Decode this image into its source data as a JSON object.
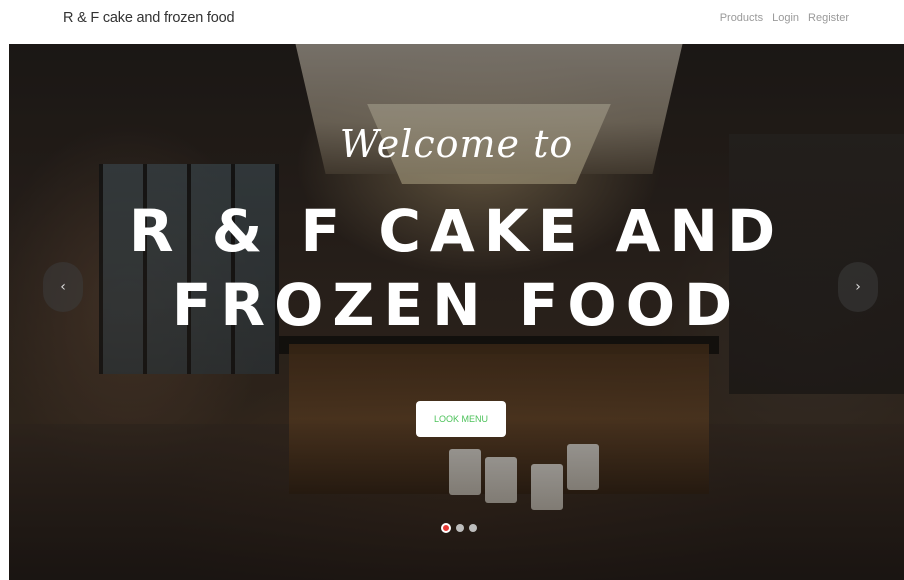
{
  "navbar": {
    "brand": "R & F cake and frozen food",
    "links": [
      "Products",
      "Login",
      "Register"
    ]
  },
  "hero": {
    "welcome": "Welcome to",
    "headline_line1": "R & F CAKE AND",
    "headline_line2": "FROZEN FOOD",
    "cta_label": "LOOK MENU",
    "prev_icon": "‹",
    "next_icon": "›",
    "slides_count": 3,
    "active_slide": 1
  },
  "colors": {
    "cta_text": "#4cc25a",
    "active_dot": "#e53935",
    "inactive_dot": "#bdbdbd"
  }
}
